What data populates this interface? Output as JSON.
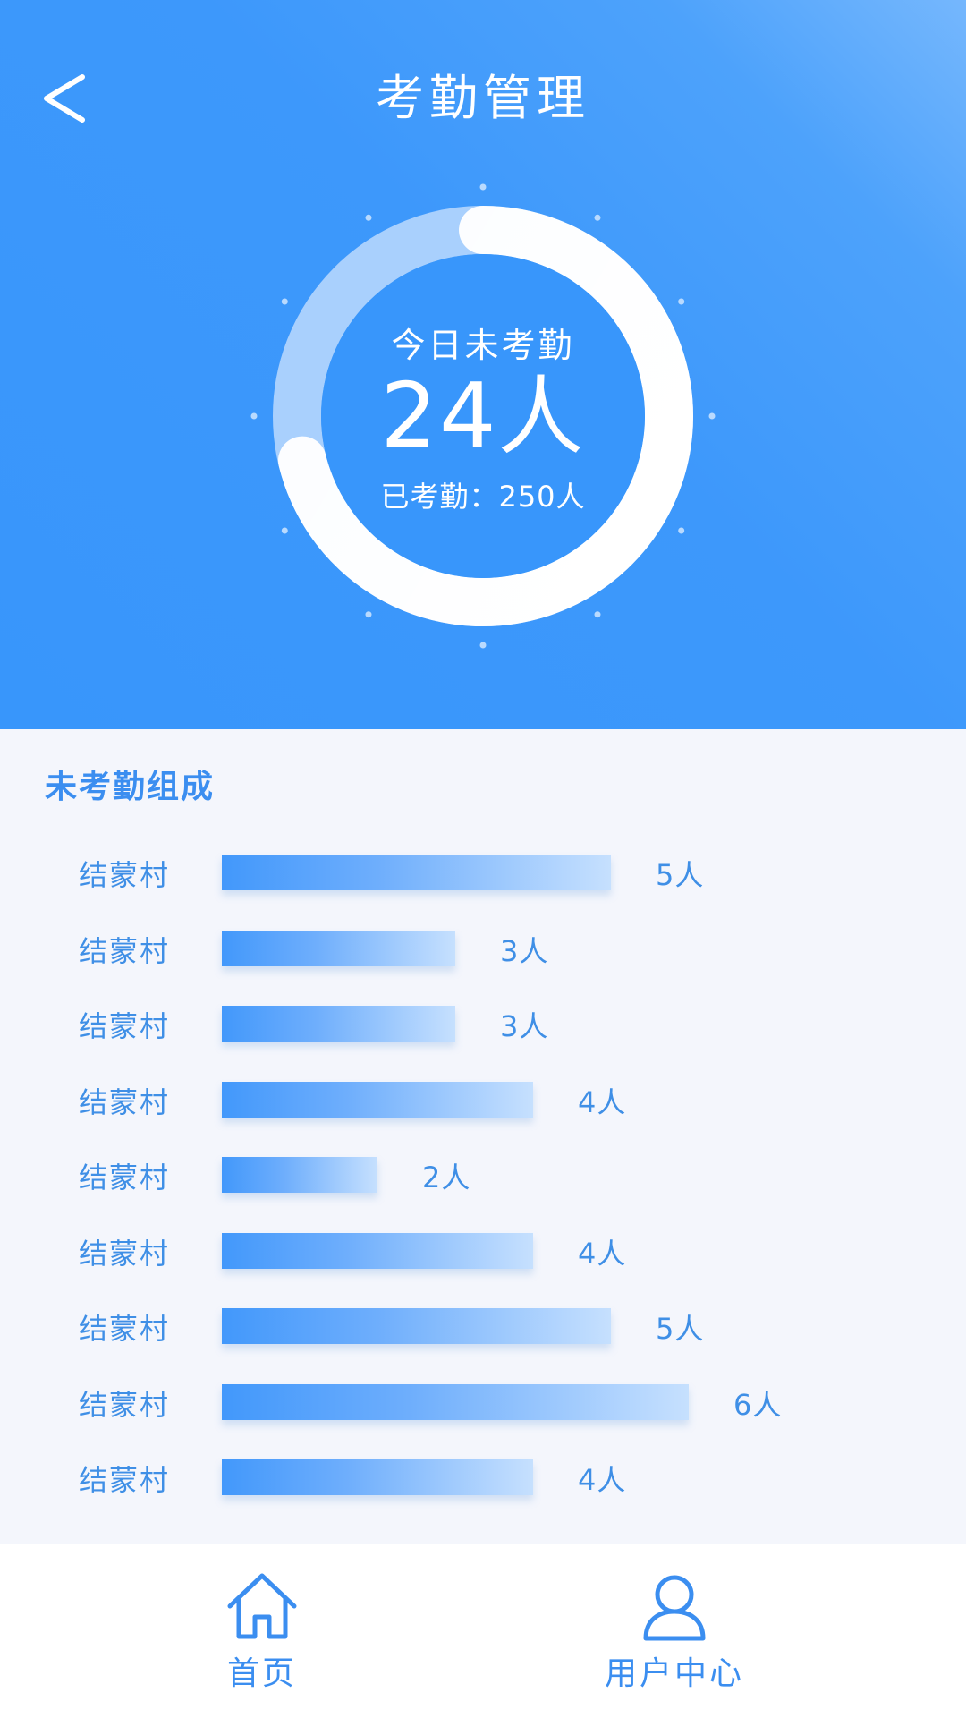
{
  "header": {
    "title": "考勤管理",
    "back_icon": "chevron-left-icon"
  },
  "summary": {
    "label": "今日未考勤",
    "absent_count": "24",
    "absent_unit": "人",
    "present_text": "已考勤：250人",
    "absent_value": 24,
    "present_value": 250
  },
  "section": {
    "title": "未考勤组成"
  },
  "chart_data": {
    "type": "bar",
    "orientation": "horizontal",
    "categories": [
      "结蒙村",
      "结蒙村",
      "结蒙村",
      "结蒙村",
      "结蒙村",
      "结蒙村",
      "结蒙村",
      "结蒙村",
      "结蒙村"
    ],
    "values": [
      5,
      3,
      3,
      4,
      2,
      4,
      5,
      6,
      4
    ],
    "value_labels": [
      "5人",
      "3人",
      "3人",
      "4人",
      "2人",
      "4人",
      "5人",
      "6人",
      "4人"
    ],
    "title": "未考勤组成"
  },
  "nav": {
    "items": [
      {
        "label": "首页",
        "icon": "home-icon"
      },
      {
        "label": "用户中心",
        "icon": "user-icon"
      }
    ]
  },
  "colors": {
    "primary": "#3896fb",
    "text_blue": "#3f8fe6",
    "background": "#f4f6fc"
  }
}
